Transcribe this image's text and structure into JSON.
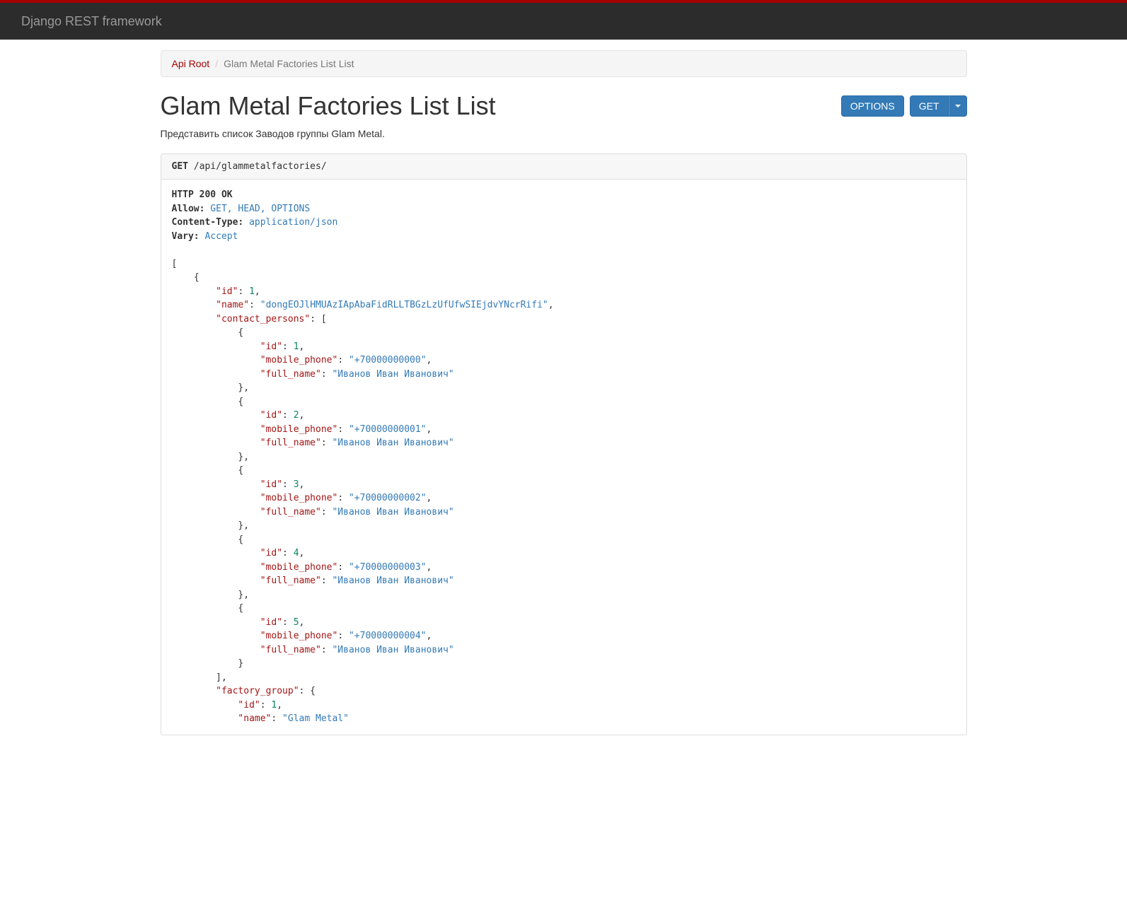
{
  "navbar": {
    "brand": "Django REST framework"
  },
  "breadcrumb": {
    "root": "Api Root",
    "sep": "/",
    "current": "Glam Metal Factories List List"
  },
  "page": {
    "title": "Glam Metal Factories List List",
    "description": "Представить список Заводов группы Glam Metal."
  },
  "buttons": {
    "options": "OPTIONS",
    "get": "GET"
  },
  "request": {
    "method": "GET",
    "path": "/api/glammetalfactories/"
  },
  "response": {
    "status": "HTTP 200 OK",
    "headers": {
      "allow_name": "Allow:",
      "allow_val": "GET, HEAD, OPTIONS",
      "ctype_name": "Content-Type:",
      "ctype_val": "application/json",
      "vary_name": "Vary:",
      "vary_val": "Accept"
    },
    "body": [
      {
        "id": 1,
        "name": "dongEOJlHMUAzIApAbaFidRLLTBGzLzUfUfwSIEjdvYNcrRifi",
        "contact_persons": [
          {
            "id": 1,
            "mobile_phone": "+70000000000",
            "full_name": "Иванов Иван Иванович"
          },
          {
            "id": 2,
            "mobile_phone": "+70000000001",
            "full_name": "Иванов Иван Иванович"
          },
          {
            "id": 3,
            "mobile_phone": "+70000000002",
            "full_name": "Иванов Иван Иванович"
          },
          {
            "id": 4,
            "mobile_phone": "+70000000003",
            "full_name": "Иванов Иван Иванович"
          },
          {
            "id": 5,
            "mobile_phone": "+70000000004",
            "full_name": "Иванов Иван Иванович"
          }
        ],
        "factory_group": {
          "id": 1,
          "name": "Glam Metal"
        }
      }
    ]
  }
}
